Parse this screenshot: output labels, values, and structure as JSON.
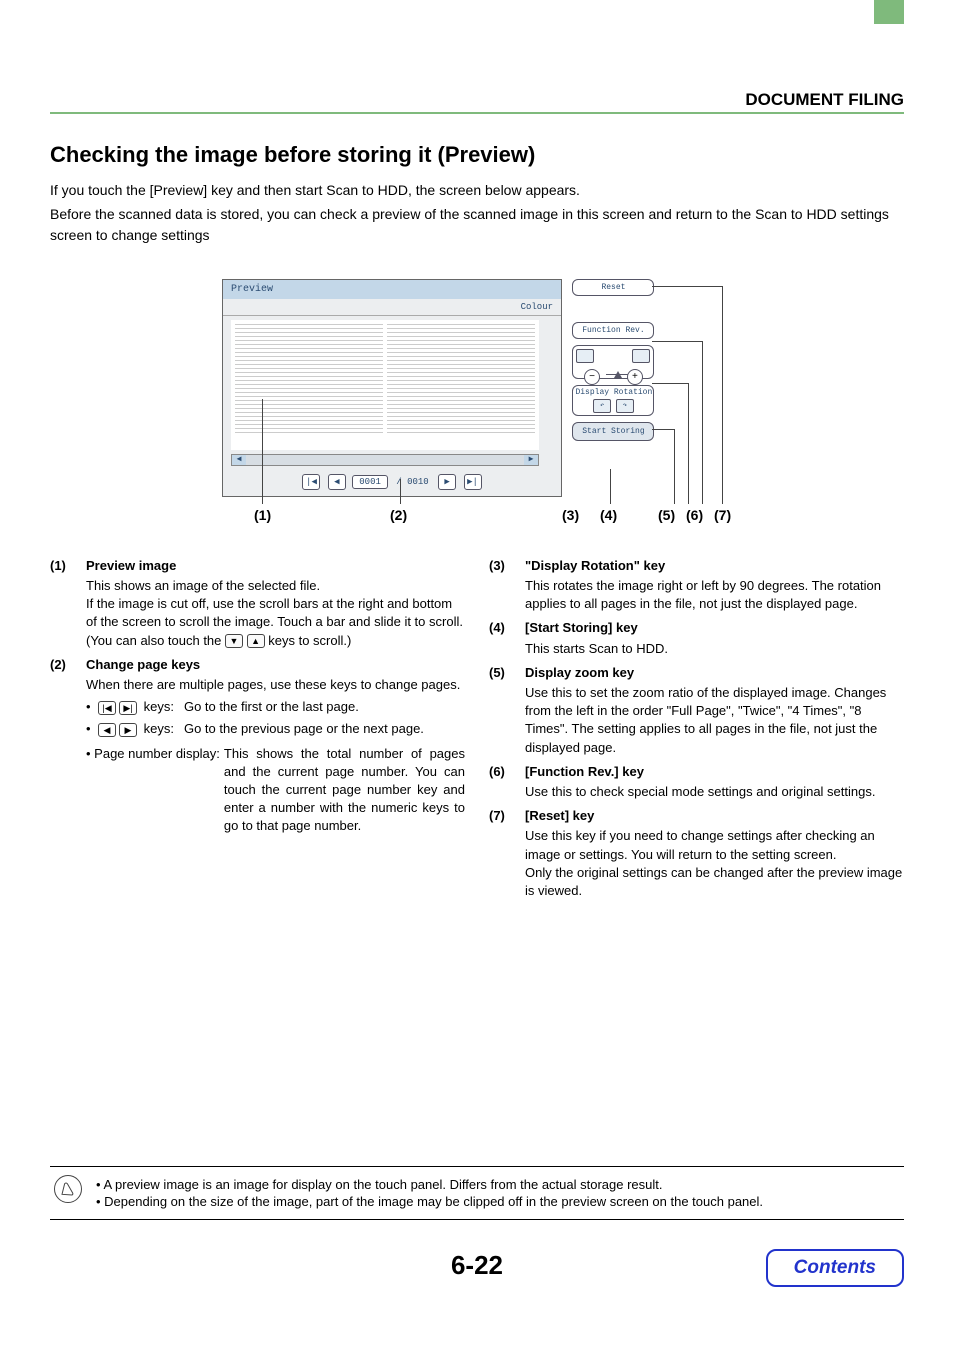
{
  "header": {
    "right_title": "DOCUMENT FILING"
  },
  "section": {
    "title": "Checking the image before storing it (Preview)",
    "intro1": "If you touch the [Preview] key and then start Scan to HDD, the screen below appears.",
    "intro2": "Before the scanned data is stored, you can check a preview of the scanned image in this screen and return to the Scan to HDD settings screen to change settings"
  },
  "diagram": {
    "preview_title": "Preview",
    "colour_label": "Colour",
    "page_counter": "0001",
    "page_total": "/ 0010",
    "side_reset": "Reset",
    "side_funcrev": "Function Rev.",
    "side_disp_rot": "Display Rotation",
    "side_start": "Start Storing"
  },
  "callouts": {
    "c1": "(1)",
    "c2": "(2)",
    "c3": "(3)",
    "c4": "(4)",
    "c5": "(5)",
    "c6": "(6)",
    "c7": "(7)"
  },
  "descriptions": {
    "i1_num": "(1)",
    "i1_title": "Preview image",
    "i1_p1": "This shows an image of the selected file.",
    "i1_p2a": "If the image is cut off, use the scroll bars at the right and bottom of the screen to scroll the image. Touch a bar and slide it to scroll. (You can also touch the ",
    "i1_p2b": " keys to scroll.)",
    "i2_num": "(2)",
    "i2_title": "Change page keys",
    "i2_p1": "When there are multiple pages, use these keys to change pages.",
    "i2_k1_label": "keys:",
    "i2_k1_text": "Go to the first or the last page.",
    "i2_k2_label": "keys:",
    "i2_k2_text": "Go to the previous page or the next page.",
    "i2_pnd_label": "• Page number display:",
    "i2_pnd_text": "This shows the total number of pages and the current page number. You can touch the current page number key and enter a number with the numeric keys to go to that page number.",
    "i3_num": "(3)",
    "i3_title": "\"Display Rotation\" key",
    "i3_text": "This rotates the image right or left by 90 degrees. The rotation applies to all pages in the file, not just the displayed page.",
    "i4_num": "(4)",
    "i4_title": "[Start Storing] key",
    "i4_text": "This starts Scan to HDD.",
    "i5_num": "(5)",
    "i5_title": "Display zoom key",
    "i5_text": "Use this to set the zoom ratio of the displayed image. Changes from the left in the order \"Full Page\", \"Twice\", \"4 Times\", \"8 Times\". The setting applies to all pages in the file, not just the displayed page.",
    "i6_num": "(6)",
    "i6_title": "[Function Rev.] key",
    "i6_text": "Use this to check special mode settings and original settings.",
    "i7_num": "(7)",
    "i7_title": "[Reset] key",
    "i7_text1": "Use this key if you need to change settings after checking an image or settings. You will return to the setting screen.",
    "i7_text2": "Only the original settings can be changed after the preview image is viewed."
  },
  "notes": {
    "n1": "A preview image is an image for display on the touch panel. Differs from the actual storage result.",
    "n2": "Depending on the size of the image, part of the image may be clipped off in the preview screen on the touch panel."
  },
  "footer": {
    "page_number": "6-22",
    "contents": "Contents"
  }
}
